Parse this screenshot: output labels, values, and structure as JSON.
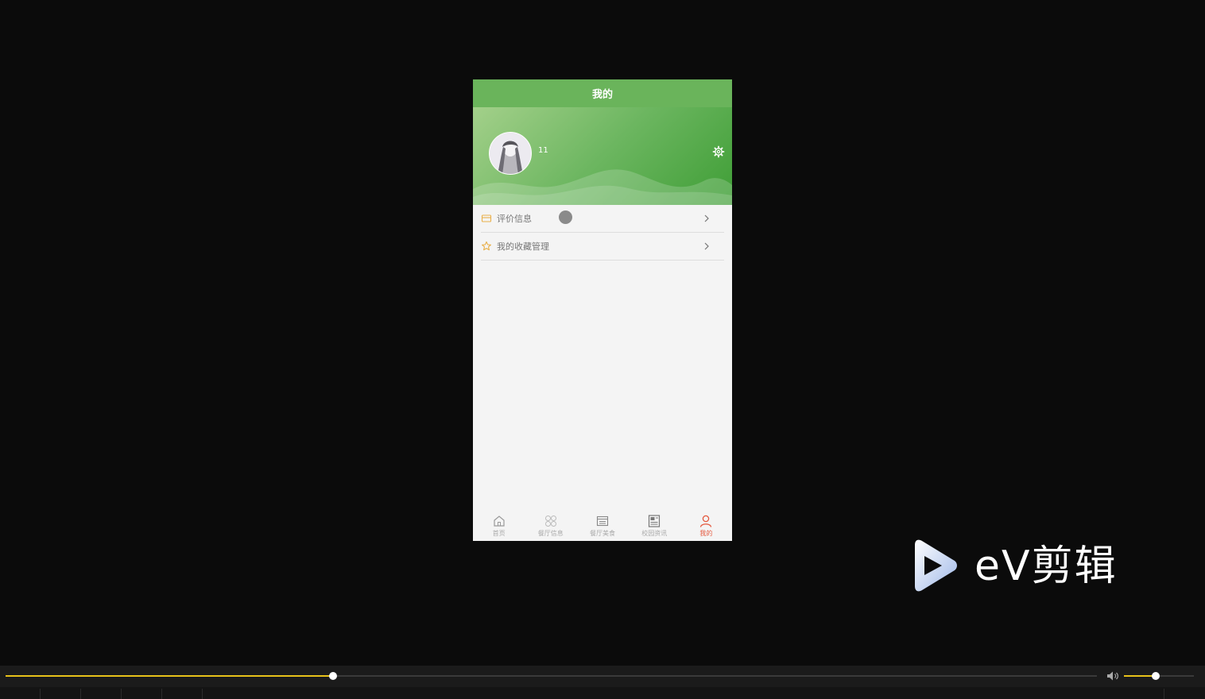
{
  "nav": {
    "title": "我的"
  },
  "profile": {
    "username": "11"
  },
  "menu": [
    {
      "label": "评价信息",
      "icon": "card-icon"
    },
    {
      "label": "我的收藏管理",
      "icon": "star-icon"
    }
  ],
  "tabs": [
    {
      "label": "首页",
      "icon": "home-icon",
      "active": false
    },
    {
      "label": "餐厅信息",
      "icon": "grid-icon",
      "active": false
    },
    {
      "label": "餐厅美食",
      "icon": "calendar-icon",
      "active": false
    },
    {
      "label": "校园资讯",
      "icon": "news-icon",
      "active": false
    },
    {
      "label": "我的",
      "icon": "user-icon",
      "active": true
    }
  ],
  "watermark": {
    "text": "eV剪辑"
  },
  "player": {
    "progress_fraction": 0.3,
    "volume_fraction": 0.45
  },
  "colors": {
    "accent": "#6ab45b",
    "active_tab": "#e4593f",
    "progress": "#e8c21a"
  }
}
